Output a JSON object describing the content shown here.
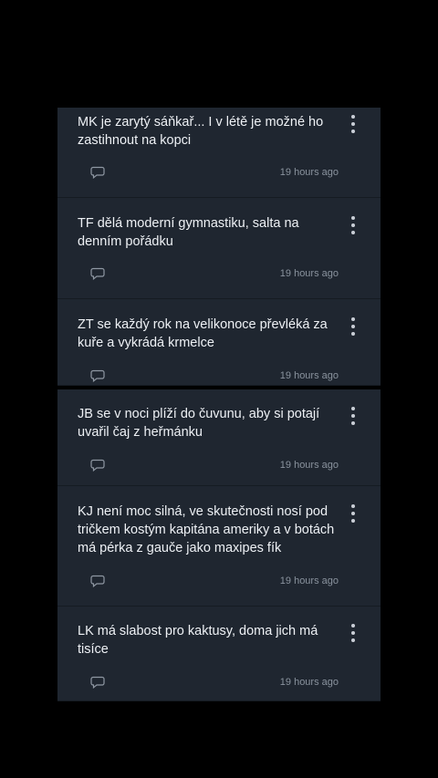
{
  "posts": [
    {
      "text": "MK je zarytý sáňkař... I v létě je možné ho zastihnout na kopci",
      "time": "19 hours ago"
    },
    {
      "text": "TF dělá moderní gymnastiku, salta na denním pořádku",
      "time": "19 hours ago"
    },
    {
      "text": "ZT se každý rok na velikonoce převléká za kuře a vykrádá krmelce",
      "time": "19 hours ago"
    },
    {
      "text": "JB se v noci plíží do čuvunu, aby si potají uvařil čaj z heřmánku",
      "time": "19 hours ago"
    },
    {
      "text": "KJ není moc silná, ve skutečnosti nosí pod tričkem kostým kapitána ameriky a v botách má pérka z gauče jako maxipes fík",
      "time": "19 hours ago"
    },
    {
      "text": "LK má slabost pro kaktusy, doma jich má tisíce",
      "time": "19 hours ago"
    }
  ],
  "icons": {
    "comment": "comment-bubble-icon",
    "more": "more-vertical-icon"
  }
}
